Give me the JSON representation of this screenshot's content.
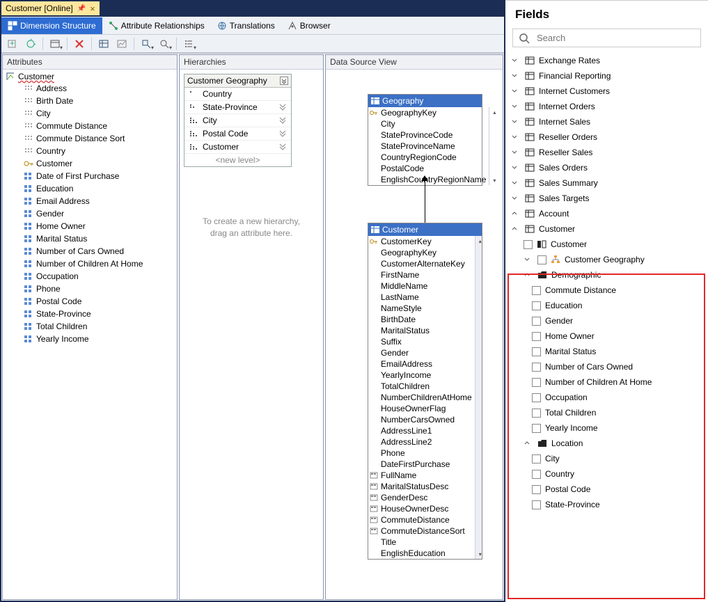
{
  "tab": {
    "title": "Customer [Online]"
  },
  "toolbar1": {
    "dim_structure": "Dimension Structure",
    "attr_rel": "Attribute Relationships",
    "translations": "Translations",
    "browser": "Browser"
  },
  "panels": {
    "attributes_header": "Attributes",
    "hierarchies_header": "Hierarchies",
    "dsv_header": "Data Source View"
  },
  "attributes": {
    "root": "Customer",
    "items": [
      "Address",
      "Birth Date",
      "City",
      "Commute Distance",
      "Commute Distance Sort",
      "Country",
      "Customer",
      "Date of First Purchase",
      "Education",
      "Email Address",
      "Gender",
      "Home Owner",
      "Marital Status",
      "Number of Cars Owned",
      "Number of Children At Home",
      "Occupation",
      "Phone",
      "Postal Code",
      "State-Province",
      "Total Children",
      "Yearly Income"
    ]
  },
  "hierarchy": {
    "title": "Customer Geography",
    "levels": [
      "Country",
      "State-Province",
      "City",
      "Postal Code",
      "Customer"
    ],
    "new_level": "<new level>",
    "hint1": "To create a new hierarchy,",
    "hint2": "drag an attribute here."
  },
  "dsv": {
    "geography": {
      "title": "Geography",
      "cols": [
        "GeographyKey",
        "City",
        "StateProvinceCode",
        "StateProvinceName",
        "CountryRegionCode",
        "PostalCode",
        "EnglishCountryRegionName"
      ]
    },
    "customer": {
      "title": "Customer",
      "cols": [
        "CustomerKey",
        "GeographyKey",
        "CustomerAlternateKey",
        "FirstName",
        "MiddleName",
        "LastName",
        "NameStyle",
        "BirthDate",
        "MaritalStatus",
        "Suffix",
        "Gender",
        "EmailAddress",
        "YearlyIncome",
        "TotalChildren",
        "NumberChildrenAtHome",
        "HouseOwnerFlag",
        "NumberCarsOwned",
        "AddressLine1",
        "AddressLine2",
        "Phone",
        "DateFirstPurchase",
        "FullName",
        "MaritalStatusDesc",
        "GenderDesc",
        "HouseOwnerDesc",
        "CommuteDistance",
        "CommuteDistanceSort",
        "Title",
        "EnglishEducation"
      ]
    }
  },
  "fields": {
    "title": "Fields",
    "search_placeholder": "Search",
    "tables": [
      "Exchange Rates",
      "Financial Reporting",
      "Internet Customers",
      "Internet Orders",
      "Internet Sales",
      "Reseller Orders",
      "Reseller Sales",
      "Sales Orders",
      "Sales Summary",
      "Sales Targets"
    ],
    "account": "Account",
    "customer": {
      "label": "Customer",
      "attr_customer": "Customer",
      "geo": "Customer Geography",
      "demographic": {
        "label": "Demographic",
        "fields": [
          "Commute Distance",
          "Education",
          "Gender",
          "Home Owner",
          "Marital Status",
          "Number of Cars Owned",
          "Number of Children At Home",
          "Occupation",
          "Total Children",
          "Yearly Income"
        ]
      },
      "location": {
        "label": "Location",
        "fields": [
          "City",
          "Country",
          "Postal Code",
          "State-Province"
        ]
      }
    }
  }
}
